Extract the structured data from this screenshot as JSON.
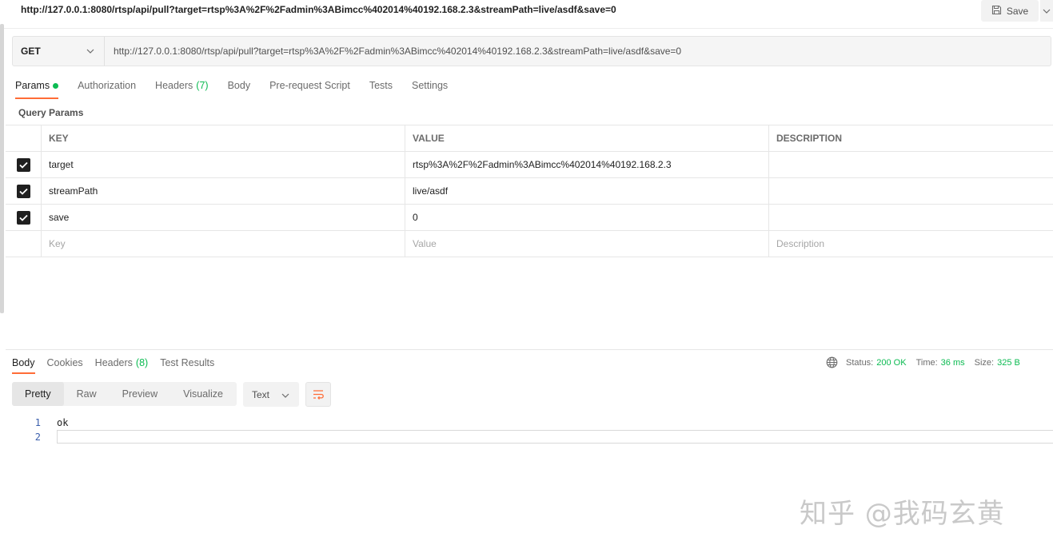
{
  "title": "http://127.0.0.1:8080/rtsp/api/pull?target=rtsp%3A%2F%2Fadmin%3ABimcc%402014%40192.168.2.3&streamPath=live/asdf&save=0",
  "save_label": "Save",
  "request": {
    "method": "GET",
    "url": "http://127.0.0.1:8080/rtsp/api/pull?target=rtsp%3A%2F%2Fadmin%3ABimcc%402014%40192.168.2.3&streamPath=live/asdf&save=0"
  },
  "request_tabs": [
    {
      "label": "Params",
      "active": true,
      "dot": true
    },
    {
      "label": "Authorization"
    },
    {
      "label": "Headers",
      "count": "(7)"
    },
    {
      "label": "Body"
    },
    {
      "label": "Pre-request Script"
    },
    {
      "label": "Tests"
    },
    {
      "label": "Settings"
    }
  ],
  "query_params": {
    "label": "Query Params",
    "headers": {
      "key": "KEY",
      "value": "VALUE",
      "description": "DESCRIPTION"
    },
    "rows": [
      {
        "checked": true,
        "key": "target",
        "value": "rtsp%3A%2F%2Fadmin%3ABimcc%402014%40192.168.2.3",
        "description": ""
      },
      {
        "checked": true,
        "key": "streamPath",
        "value": "live/asdf",
        "description": ""
      },
      {
        "checked": true,
        "key": "save",
        "value": "0",
        "description": ""
      }
    ],
    "placeholders": {
      "key": "Key",
      "value": "Value",
      "description": "Description"
    }
  },
  "response_tabs": [
    {
      "label": "Body",
      "active": true
    },
    {
      "label": "Cookies"
    },
    {
      "label": "Headers",
      "count": "(8)"
    },
    {
      "label": "Test Results"
    }
  ],
  "status": {
    "status_label": "Status:",
    "status_value": "200 OK",
    "time_label": "Time:",
    "time_value": "36 ms",
    "size_label": "Size:",
    "size_value": "325 B"
  },
  "view_modes": [
    "Pretty",
    "Raw",
    "Preview",
    "Visualize"
  ],
  "active_view": "Pretty",
  "format": "Text",
  "body_lines": [
    {
      "n": "1",
      "text": "ok"
    },
    {
      "n": "2",
      "text": ""
    }
  ],
  "watermark": "知乎 @我码玄黄",
  "colors": {
    "accent": "#ff6c37",
    "success": "#0cbb52"
  }
}
